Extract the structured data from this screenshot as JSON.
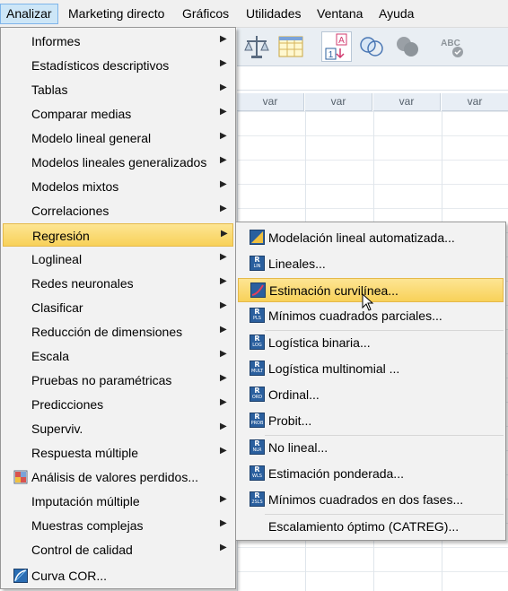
{
  "menubar": {
    "items": [
      {
        "label": "Analizar",
        "active": true
      },
      {
        "label": "Marketing directo"
      },
      {
        "label": "Gráficos"
      },
      {
        "label": "Utilidades"
      },
      {
        "label": "Ventana"
      },
      {
        "label": "Ayuda"
      }
    ]
  },
  "grid": {
    "column_header": "var"
  },
  "analyze_menu": {
    "items": [
      {
        "label": "Informes",
        "submenu": true
      },
      {
        "label": "Estadísticos descriptivos",
        "submenu": true
      },
      {
        "label": "Tablas",
        "submenu": true
      },
      {
        "label": "Comparar medias",
        "submenu": true
      },
      {
        "label": "Modelo lineal general",
        "submenu": true
      },
      {
        "label": "Modelos lineales generalizados",
        "submenu": true
      },
      {
        "label": "Modelos mixtos",
        "submenu": true
      },
      {
        "label": "Correlaciones",
        "submenu": true
      },
      {
        "label": "Regresión",
        "submenu": true,
        "highlighted": true
      },
      {
        "label": "Loglineal",
        "submenu": true
      },
      {
        "label": "Redes neuronales",
        "submenu": true
      },
      {
        "label": "Clasificar",
        "submenu": true
      },
      {
        "label": "Reducción de dimensiones",
        "submenu": true
      },
      {
        "label": "Escala",
        "submenu": true
      },
      {
        "label": "Pruebas no paramétricas",
        "submenu": true
      },
      {
        "label": "Predicciones",
        "submenu": true
      },
      {
        "label": "Superviv.",
        "submenu": true
      },
      {
        "label": "Respuesta múltiple",
        "submenu": true
      },
      {
        "label": "Análisis de valores perdidos...",
        "submenu": false,
        "icon": "missing-values-icon"
      },
      {
        "label": "Imputación múltiple",
        "submenu": true
      },
      {
        "label": "Muestras complejas",
        "submenu": true
      },
      {
        "label": "Control de calidad",
        "submenu": true
      },
      {
        "label": "Curva COR...",
        "submenu": false,
        "icon": "roc-curve-icon"
      }
    ]
  },
  "regression_menu": {
    "items": [
      {
        "label": "Modelación lineal automatizada...",
        "icon_code": ""
      },
      {
        "label": "Lineales...",
        "icon_code": "LIN"
      },
      {
        "label": "Estimación curvilínea...",
        "icon_code": "",
        "highlighted": true
      },
      {
        "label": "Mínimos cuadrados parciales...",
        "icon_code": "PLS"
      },
      {
        "label": "Logística binaria...",
        "icon_code": "LOG"
      },
      {
        "label": "Logística multinomial ...",
        "icon_code": "MULT"
      },
      {
        "label": "Ordinal...",
        "icon_code": "ORD"
      },
      {
        "label": "Probit...",
        "icon_code": "PROB"
      },
      {
        "label": "No lineal...",
        "icon_code": "NLR"
      },
      {
        "label": "Estimación ponderada...",
        "icon_code": "WLS"
      },
      {
        "label": "Mínimos cuadrados en dos fases...",
        "icon_code": "2SLS"
      },
      {
        "label": "Escalamiento óptimo (CATREG)...",
        "icon_code": ""
      }
    ]
  },
  "colors": {
    "highlight": "#f8d159",
    "menu_bg": "#f2f2f2",
    "menubar_active": "#cde6f7"
  }
}
